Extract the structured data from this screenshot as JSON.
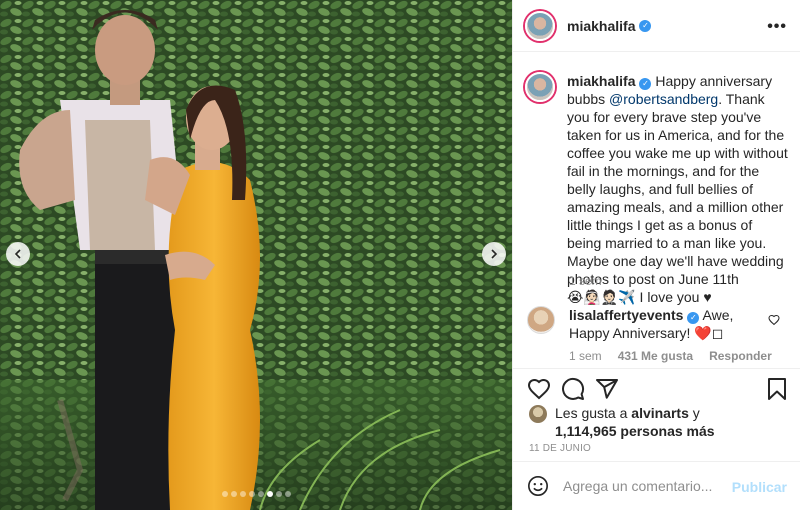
{
  "post": {
    "username": "miakhalifa",
    "verified_icon": "check-icon",
    "more_label": "•••"
  },
  "caption": {
    "username": "miakhalifa",
    "text_before": " Happy anniversary bubbs ",
    "mention": "@robertsandberg",
    "text_after": ". Thank you for every brave step you've taken for us in America, and for the coffee you wake me up with without fail in the mornings, and for the belly laughs, and full bellies of amazing meals, and a million other little things I get as a bonus of being married to a man like you. Maybe one day we'll have wedding photos to post on June 11th",
    "emoji_line": "😭👰🏻🤵🏻✈️ I love you ♥",
    "time": "1 sem"
  },
  "comment": {
    "username": "lisalaffertyevents",
    "text": " Awe, Happy Anniversary! ",
    "emoji": "❤️",
    "box": "◻",
    "time": "1 sem",
    "likes": "431 Me gusta",
    "reply": "Responder"
  },
  "actions": {
    "icons": [
      "heart-icon",
      "comment-icon",
      "share-icon",
      "bookmark-icon"
    ]
  },
  "likes": {
    "prefix": "Les gusta a ",
    "user": "alvinarts",
    "middle": " y",
    "count": "1,114,965 personas más"
  },
  "date": "11 DE JUNIO",
  "add_comment": {
    "placeholder": "Agrega un comentario...",
    "publish": "Publicar"
  },
  "carousel": {
    "total": 8,
    "active": 6
  },
  "colors": {
    "link": "#00376b",
    "verified": "#3897f0",
    "publish_disabled": "#b2dffc",
    "heart": "#ed4956"
  }
}
